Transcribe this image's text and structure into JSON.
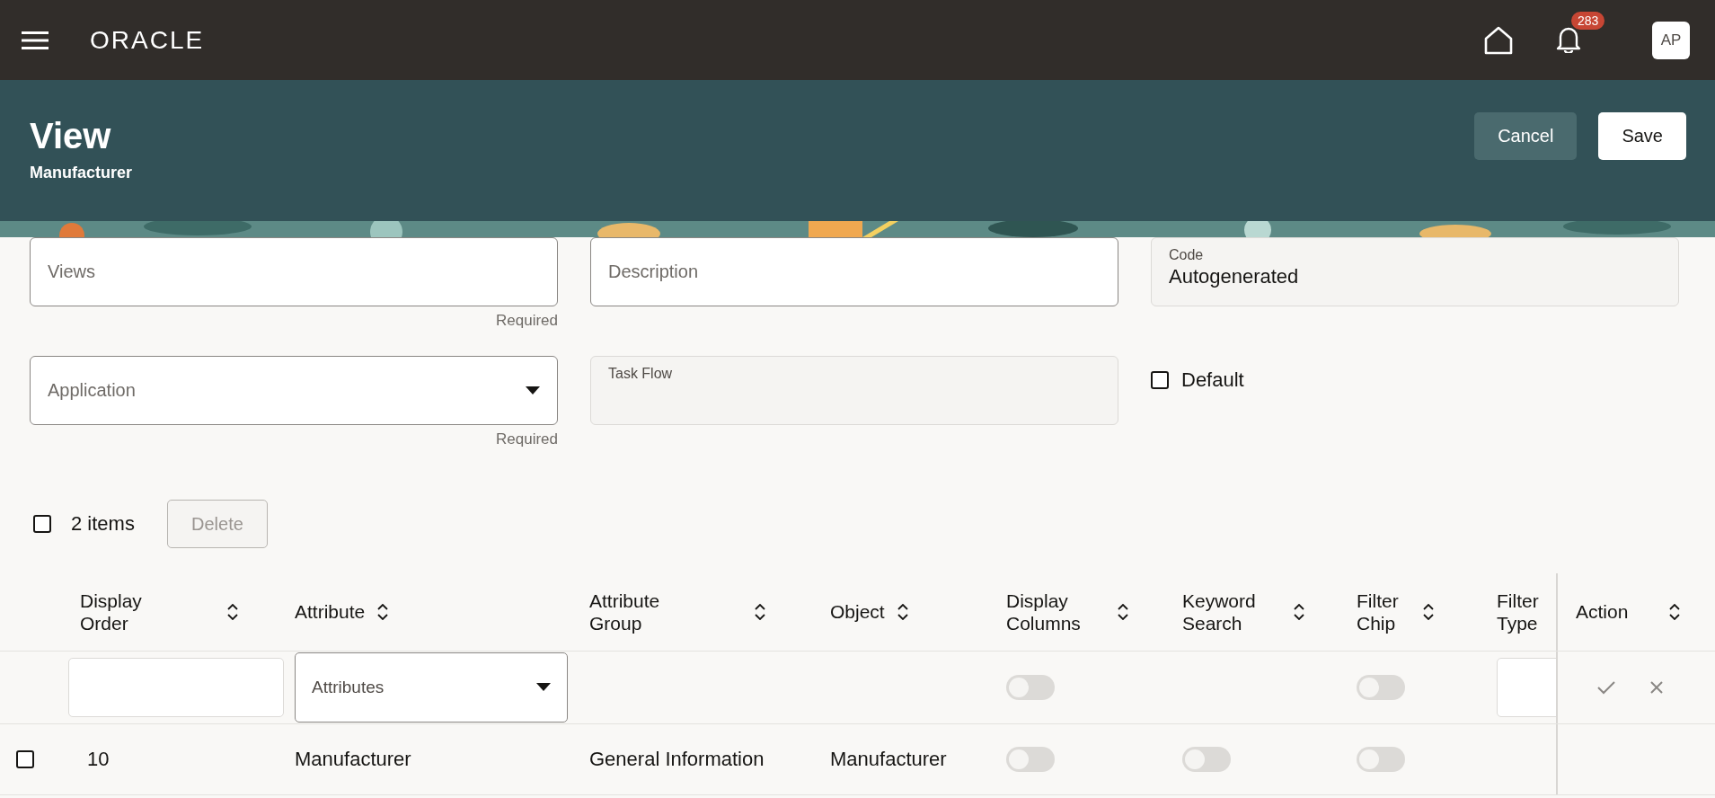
{
  "app_bar": {
    "brand": "ORACLE",
    "notifications": "283",
    "avatar": "AP"
  },
  "header": {
    "title": "View",
    "subtitle": "Manufacturer",
    "buttons": [
      {
        "label": "Cancel",
        "kind": "secondary"
      },
      {
        "label": "Save",
        "kind": "primary"
      }
    ]
  },
  "form": {
    "fields": [
      {
        "kind": "text",
        "label": "Views",
        "helper": "Required"
      },
      {
        "kind": "text",
        "label": "Description"
      },
      {
        "kind": "readonly",
        "label": "Code",
        "value": "Autogenerated"
      },
      {
        "kind": "select",
        "label": "Application",
        "helper": "Required"
      },
      {
        "kind": "readonly",
        "label": "Task Flow"
      },
      {
        "kind": "checkbox",
        "label": "Default",
        "checked": false
      }
    ]
  },
  "toolbar": {
    "select_all": false,
    "count": "2 items",
    "delete": {
      "label": "Delete",
      "disabled": true
    }
  },
  "table": {
    "columns": [
      {
        "label": [
          "Display",
          "Order"
        ]
      },
      {
        "label": [
          "Attribute"
        ]
      },
      {
        "label": [
          "Attribute",
          "Group"
        ]
      },
      {
        "label": [
          "Object"
        ]
      },
      {
        "label": [
          "Display",
          "Columns"
        ]
      },
      {
        "label": [
          "Keyword",
          "Search"
        ]
      },
      {
        "label": [
          "Filter",
          "Chip"
        ]
      },
      {
        "label": [
          "Filter",
          "Type"
        ]
      }
    ],
    "action_column": "Action",
    "filter_row": [
      {
        "kind": "input"
      },
      {
        "kind": "select",
        "placeholder": "Attributes"
      },
      {
        "kind": "empty"
      },
      {
        "kind": "empty"
      },
      {
        "kind": "toggle",
        "on": false
      },
      {
        "kind": "empty"
      },
      {
        "kind": "toggle",
        "on": false
      },
      {
        "kind": "input"
      }
    ],
    "rows": [
      {
        "selected": false,
        "cells": [
          {
            "kind": "text",
            "text": "10"
          },
          {
            "kind": "text",
            "text": "Manufacturer"
          },
          {
            "kind": "text",
            "text": "General Information"
          },
          {
            "kind": "text",
            "text": "Manufacturer"
          },
          {
            "kind": "toggle",
            "on": false
          },
          {
            "kind": "toggle",
            "on": false
          },
          {
            "kind": "toggle",
            "on": false
          },
          {
            "kind": "empty"
          }
        ]
      }
    ]
  }
}
